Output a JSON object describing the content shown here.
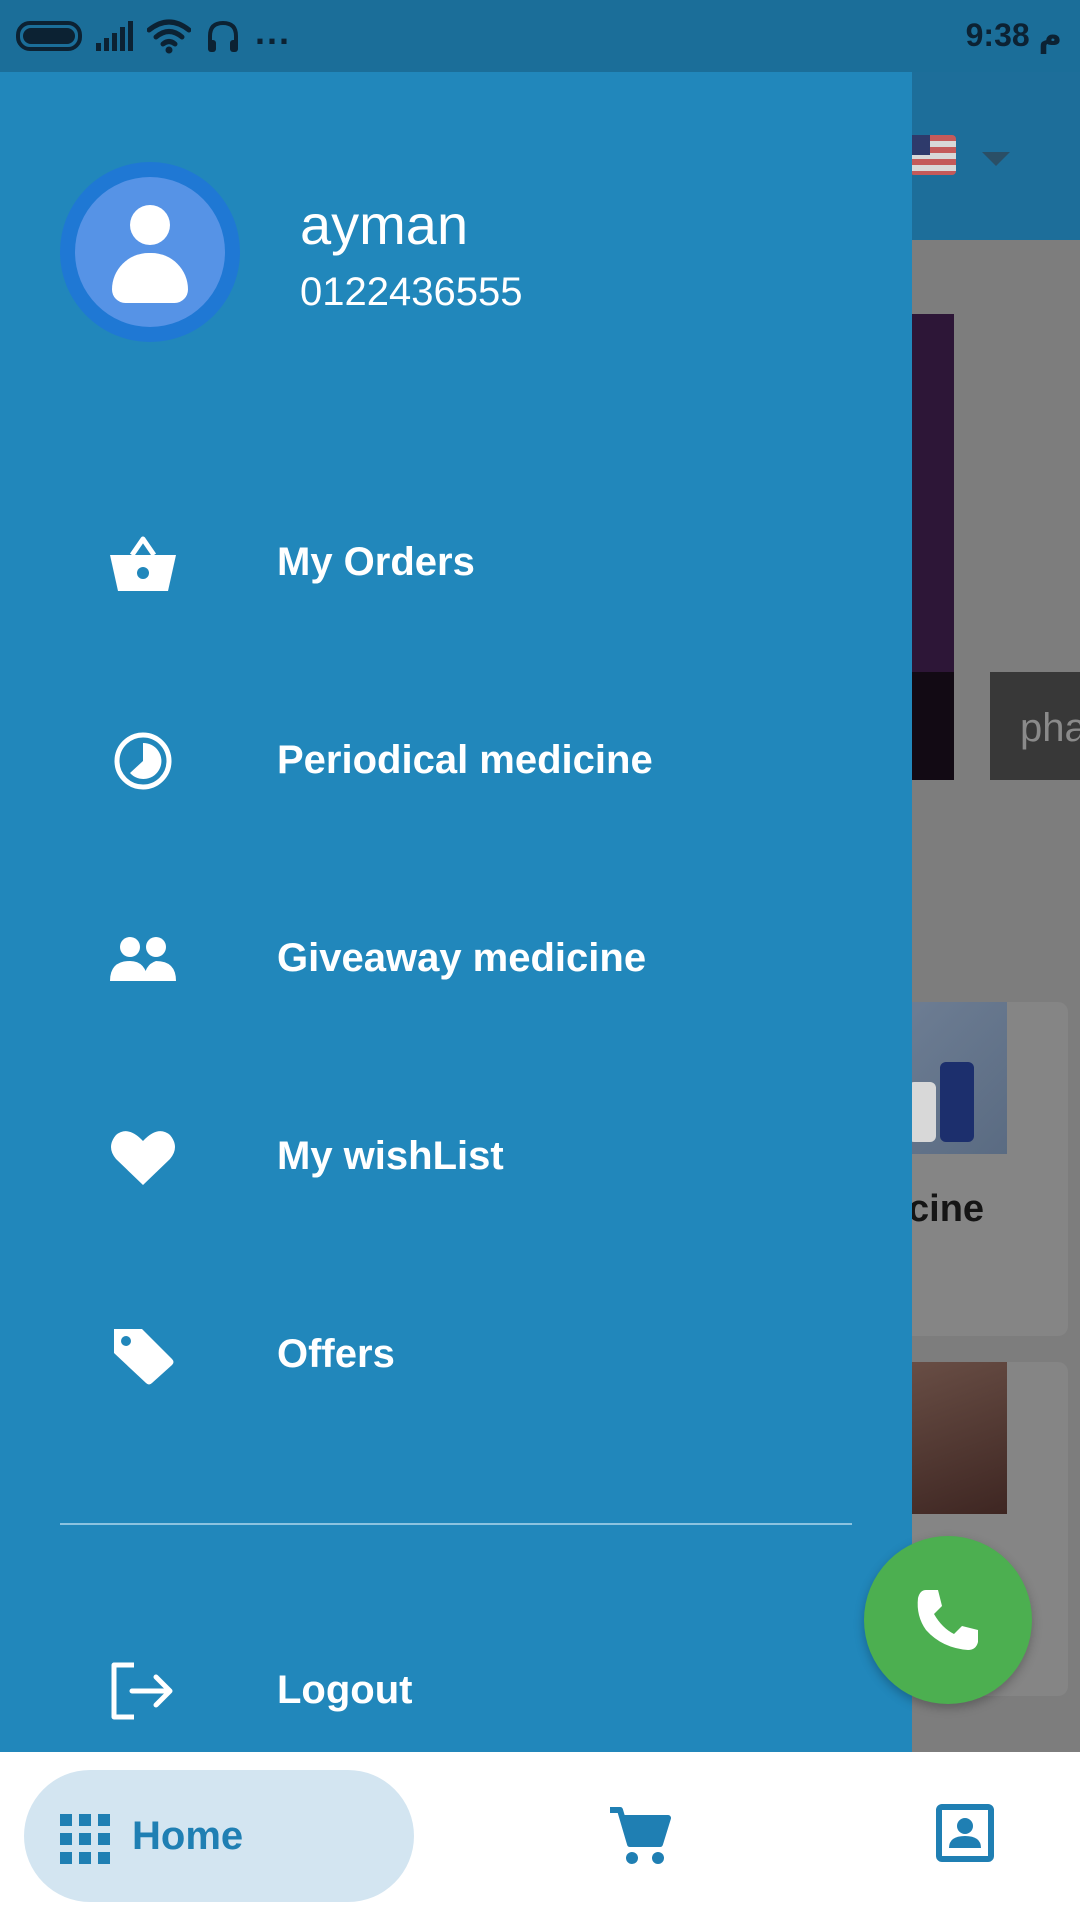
{
  "status_bar": {
    "time": "9:38 م",
    "dots": "..."
  },
  "background": {
    "chip_text": "pha",
    "card_label": "cine"
  },
  "profile": {
    "name": "ayman",
    "phone": "0122436555"
  },
  "menu": {
    "items": [
      {
        "label": "My Orders",
        "icon": "basket-icon"
      },
      {
        "label": "Periodical medicine",
        "icon": "clock-icon"
      },
      {
        "label": "Giveaway medicine",
        "icon": "people-icon"
      },
      {
        "label": "My wishList",
        "icon": "heart-icon"
      },
      {
        "label": "Offers",
        "icon": "tag-icon"
      }
    ],
    "logout": {
      "label": "Logout",
      "icon": "logout-icon"
    }
  },
  "fab": {
    "icon": "phone-icon"
  },
  "bottom_nav": {
    "home_label": "Home",
    "home_icon": "grid-icon",
    "cart_icon": "cart-icon",
    "contacts_icon": "contact-card-icon"
  },
  "colors": {
    "drawer": "#2187bb",
    "status_bar": "#1b6e99",
    "fab": "#4caf50",
    "nav_active_pill": "#d3e5f1",
    "nav_active": "#1f7fb3",
    "avatar_ring": "#1f78d4",
    "avatar": "#5693e6"
  }
}
